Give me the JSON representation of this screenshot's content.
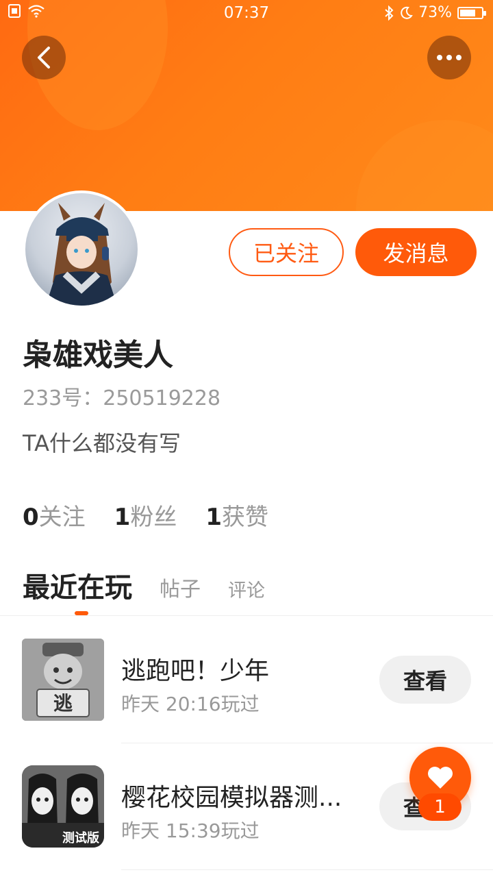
{
  "status_bar": {
    "time": "07:37",
    "battery": "73%",
    "battery_level": 0.73
  },
  "header": {
    "back_icon": "chevron-left-icon",
    "more_icon": "more-dots-icon"
  },
  "profile": {
    "username": "枭雄戏美人",
    "user_id": "233号：250519228",
    "bio": "TA什么都没有写",
    "follow_status_label": "已关注",
    "message_label": "发消息",
    "stats": [
      {
        "num": "0",
        "label": "关注"
      },
      {
        "num": "1",
        "label": "粉丝"
      },
      {
        "num": "1",
        "label": "获赞"
      }
    ]
  },
  "tabs": [
    {
      "label": "最近在玩",
      "active": true
    },
    {
      "label": "帖子",
      "active": false
    },
    {
      "label": "评论",
      "active": false
    }
  ],
  "games": [
    {
      "title": "逃跑吧！少年",
      "subtitle": "昨天 20:16玩过",
      "button": "查看",
      "icon_text": "逃"
    },
    {
      "title": "樱花校园模拟器测...",
      "subtitle": "昨天 15:39玩过",
      "button": "查看",
      "icon_text": "测试版"
    }
  ],
  "like_fab": {
    "icon": "heart-icon",
    "count": "1"
  },
  "colors": {
    "accent": "#ff5a0a",
    "banner": "#ff7d14"
  }
}
